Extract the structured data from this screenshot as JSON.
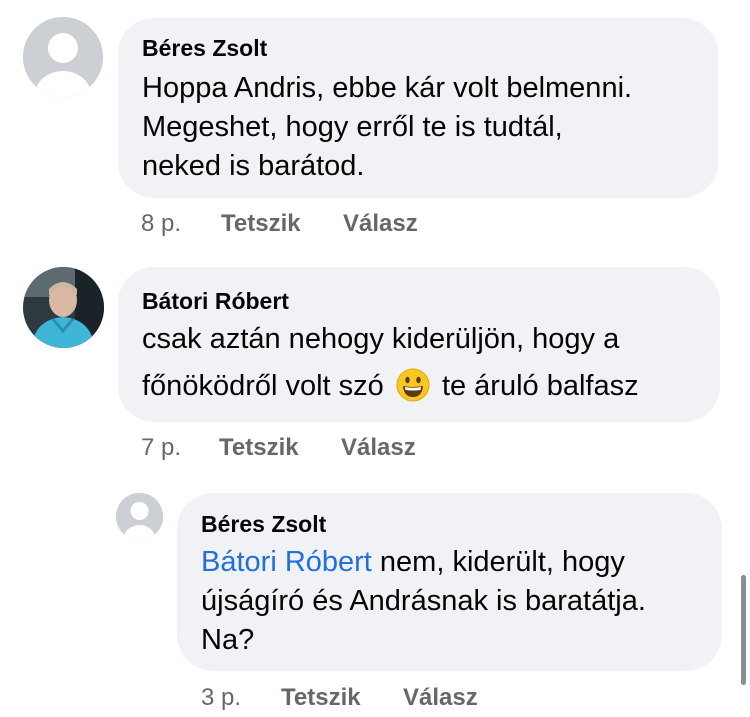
{
  "comments": [
    {
      "author": "Béres Zsolt",
      "lines": [
        "Hoppa Andris, ebbe kár volt belmenni.",
        "Megeshet, hogy erről te is tudtál,",
        "neked is barátod."
      ],
      "time": "8 p.",
      "like_label": "Tetszik",
      "reply_label": "Válasz"
    },
    {
      "author": "Bátori Róbert",
      "line1": "csak aztán nehogy kiderüljön, hogy a",
      "line2_before": "főnöködről volt szó",
      "line2_after": "te áruló balfasz",
      "emoji": "grinning-face-emoji",
      "time": "7 p.",
      "like_label": "Tetszik",
      "reply_label": "Válasz"
    },
    {
      "author": "Béres Zsolt",
      "mention": "Bátori Róbert",
      "line1_rest": " nem, kiderült, hogy",
      "lines": [
        "újságíró és Andrásnak is baratátja.",
        "Na?"
      ],
      "time": "3 p.",
      "like_label": "Tetszik",
      "reply_label": "Válasz"
    }
  ],
  "colors": {
    "bubble": "#f0f2f5",
    "mention": "#216fdb",
    "meta": "#65676b",
    "avatar_placeholder": "#ccd0d5"
  }
}
